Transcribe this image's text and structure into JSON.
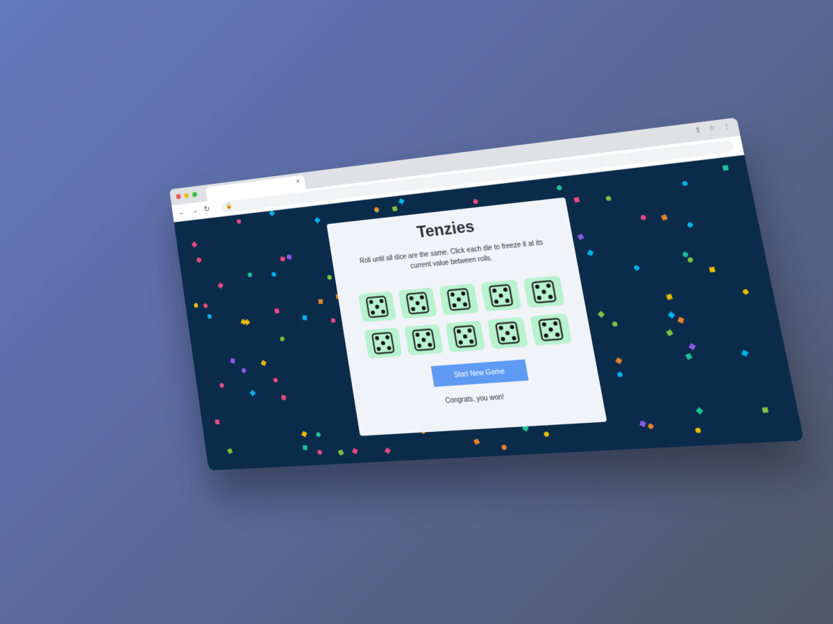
{
  "browser": {
    "tab_close": "×",
    "actions": [
      "share-icon",
      "star-icon",
      "menu-icon"
    ]
  },
  "game": {
    "title": "Tenzies",
    "instructions": "Roll until all dice are the same. Click each die to freeze it at its current value between rolls.",
    "button_label": "Start New Game",
    "status": "Congrats, you won!",
    "dice_value": 5,
    "dice": [
      5,
      5,
      5,
      5,
      5,
      5,
      5,
      5,
      5,
      5
    ]
  },
  "colors": {
    "page_background_start": "#6478bd",
    "page_background_end": "#4f5868",
    "app_background": "#0b2b4a",
    "card": "#f0f3f8",
    "die_held": "#b8f2cf",
    "button": "#5f9bf2"
  }
}
